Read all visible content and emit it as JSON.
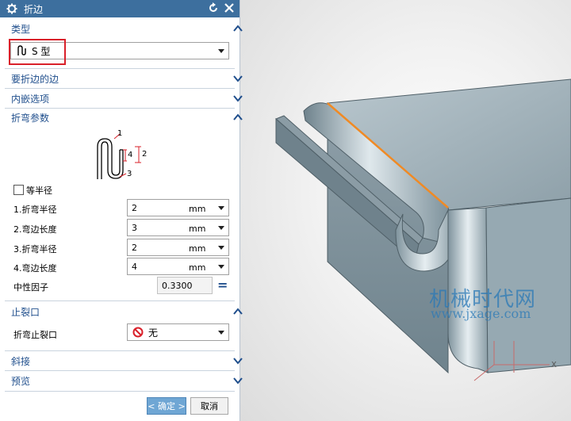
{
  "dialog": {
    "title": "折边",
    "sections": {
      "type": "类型",
      "edges": "要折边的边",
      "inset": "内嵌选项",
      "bend_params": "折弯参数",
      "relief": "止裂口",
      "miter": "斜接",
      "preview": "预览"
    },
    "type_select": {
      "value": "S 型"
    },
    "equal_radius": {
      "label": "等半径",
      "checked": false
    },
    "params": [
      {
        "label": "1.折弯半径",
        "value": "2",
        "unit": "mm"
      },
      {
        "label": "2.弯边长度",
        "value": "3",
        "unit": "mm"
      },
      {
        "label": "3.折弯半径",
        "value": "2",
        "unit": "mm"
      },
      {
        "label": "4.弯边长度",
        "value": "4",
        "unit": "mm"
      }
    ],
    "neutral_factor": {
      "label": "中性因子",
      "value": "0.3300",
      "eq": "="
    },
    "relief_select": {
      "label": "折弯止裂口",
      "value": "无"
    },
    "diagram_labels": {
      "l1": "1",
      "l2": "2",
      "l3": "3",
      "l4": "4"
    },
    "ok_label": "< 确定 >",
    "cancel_label": "取消"
  },
  "watermark": {
    "cn": "机械时代网",
    "url": "www.jxage.com"
  },
  "axis": {
    "x": "X"
  },
  "colors": {
    "title_bg": "#3d6f9e",
    "section_text": "#1f4e8c",
    "highlight": "#d9202a",
    "edge_orange": "#f08a24",
    "model": "#8fa3ad"
  }
}
